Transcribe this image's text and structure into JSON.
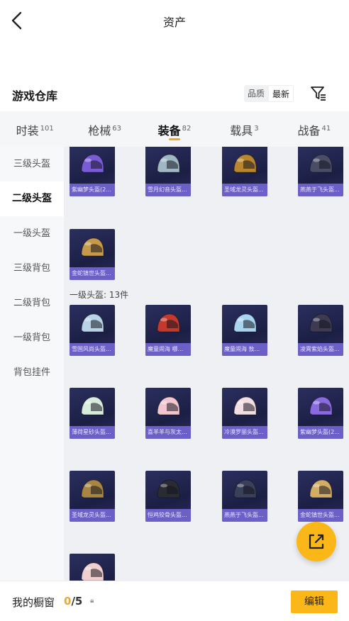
{
  "header": {
    "title": "资产"
  },
  "section": {
    "title": "游戏仓库",
    "sort_options": [
      "品质",
      "最新"
    ],
    "sort_active": "最新"
  },
  "tabs": [
    {
      "label": "时装",
      "count": "101"
    },
    {
      "label": "枪械",
      "count": "63"
    },
    {
      "label": "装备",
      "count": "82"
    },
    {
      "label": "载具",
      "count": "3"
    },
    {
      "label": "战备",
      "count": "41"
    }
  ],
  "sidebar": {
    "items": [
      "三级头盔",
      "二级头盔",
      "一级头盔",
      "三级背包",
      "二级背包",
      "一级背包",
      "背包挂件"
    ],
    "active": "二级头盔"
  },
  "grid": {
    "group_label": "一级头盔: 13件",
    "top_items": [
      {
        "name": "紫幽梦头盔(2...",
        "color": "#7a5bd6"
      },
      {
        "name": "雪月幻音头盔...",
        "color": "#9fb8c4"
      },
      {
        "name": "圣域龙灵头盔...",
        "color": "#b8862e"
      },
      {
        "name": "燕燕于飞头盔...",
        "color": "#4a4d66"
      },
      {
        "name": "金蛇镇世头盔...",
        "color": "#c59a4a"
      }
    ],
    "level1_items": [
      {
        "name": "雪国风尚头盔...",
        "color": "#b9d3e6"
      },
      {
        "name": "魔童闹海 哪...",
        "color": "#c23a2e"
      },
      {
        "name": "魔童闹海 敖...",
        "color": "#a8d4ee"
      },
      {
        "name": "凌霄紫焰头盔...",
        "color": "#3d3a52"
      },
      {
        "name": "薄荷星砂头盔...",
        "color": "#d7ecdd"
      },
      {
        "name": "喜羊羊与灰太...",
        "color": "#f2c6cf"
      },
      {
        "name": "冷漠罗丽头盔...",
        "color": "#f1dfe3"
      },
      {
        "name": "紫幽梦头盔(2...",
        "color": "#8a6ae0"
      },
      {
        "name": "圣域龙灵头盔...",
        "color": "#a98542"
      },
      {
        "name": "恒鸡狡骨头盔...",
        "color": "#2b2c33"
      },
      {
        "name": "燕燕于飞头盔...",
        "color": "#3a3f5a"
      },
      {
        "name": "金蛇镇世头盔...",
        "color": "#d2ad63"
      },
      {
        "name": "",
        "color": "#f0cfcf"
      }
    ]
  },
  "bottom": {
    "label": "我的橱窗",
    "used": "0",
    "total": "/5",
    "lock_icon": "lock-icon",
    "edit_label": "编辑"
  },
  "colors": {
    "accent": "#fbb617",
    "card_name_bg": "#6c5fc7"
  }
}
